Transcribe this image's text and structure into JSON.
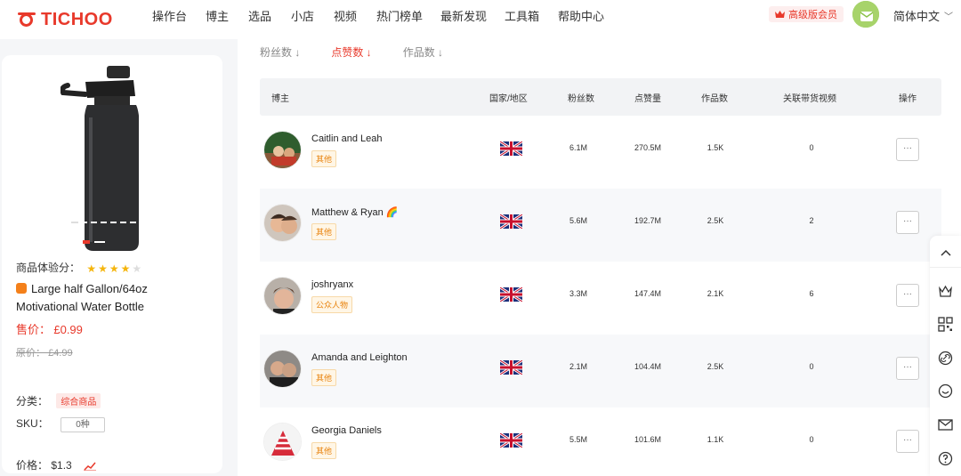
{
  "brand": {
    "name": "TICHOO",
    "color": "#e8392b"
  },
  "nav": [
    "操作台",
    "博主",
    "选品",
    "小店",
    "视频",
    "热门榜单",
    "最新发现",
    "工具箱",
    "帮助中心"
  ],
  "header": {
    "vip_label": "高级版会员",
    "language": "简体中文"
  },
  "product": {
    "rating_label": "商品体验分：",
    "rating_stars": 4,
    "rating_max": 5,
    "title": "Large half Gallon/64oz Motivational Water Bottle",
    "price_label": "售价：",
    "price": "£0.99",
    "original_price_label": "原价：",
    "original_price": "£4.99",
    "category_label": "分类：",
    "category": "综合商品",
    "sku_label": "SKU：",
    "sku_value": "0种",
    "cost_label": "价格：",
    "cost": "$1.3"
  },
  "sort_tabs": [
    {
      "label": "粉丝数 ↓",
      "active": false
    },
    {
      "label": "点赞数 ↓",
      "active": true
    },
    {
      "label": "作品数 ↓",
      "active": false
    }
  ],
  "table": {
    "headers": {
      "creator": "博主",
      "region": "国家/地区",
      "followers": "粉丝数",
      "likes": "点赞量",
      "videos": "作品数",
      "related": "关联带货视频",
      "actions": "操作"
    },
    "rows": [
      {
        "name": "Caitlin and Leah",
        "tag": "其他",
        "region": "UK",
        "followers": "6.1M",
        "likes": "270.5M",
        "videos": "1.5K",
        "related": "0",
        "more": "···"
      },
      {
        "name": "Matthew & Ryan 🌈",
        "tag": "其他",
        "region": "UK",
        "followers": "5.6M",
        "likes": "192.7M",
        "videos": "2.5K",
        "related": "2",
        "more": "···"
      },
      {
        "name": "joshryanx",
        "tag": "公众人物",
        "region": "UK",
        "followers": "3.3M",
        "likes": "147.4M",
        "videos": "2.1K",
        "related": "6",
        "more": "···"
      },
      {
        "name": "Amanda and Leighton",
        "tag": "其他",
        "region": "UK",
        "followers": "2.1M",
        "likes": "104.4M",
        "videos": "2.5K",
        "related": "0",
        "more": "···"
      },
      {
        "name": "Georgia Daniels",
        "tag": "其他",
        "region": "UK",
        "followers": "5.5M",
        "likes": "101.6M",
        "videos": "1.1K",
        "related": "0",
        "more": "···"
      }
    ]
  },
  "float_bar": {
    "up": "^",
    "icons": [
      "crown-outline-icon",
      "qr-code-icon",
      "link-icon",
      "smile-icon",
      "mail-icon",
      "help-icon"
    ]
  }
}
